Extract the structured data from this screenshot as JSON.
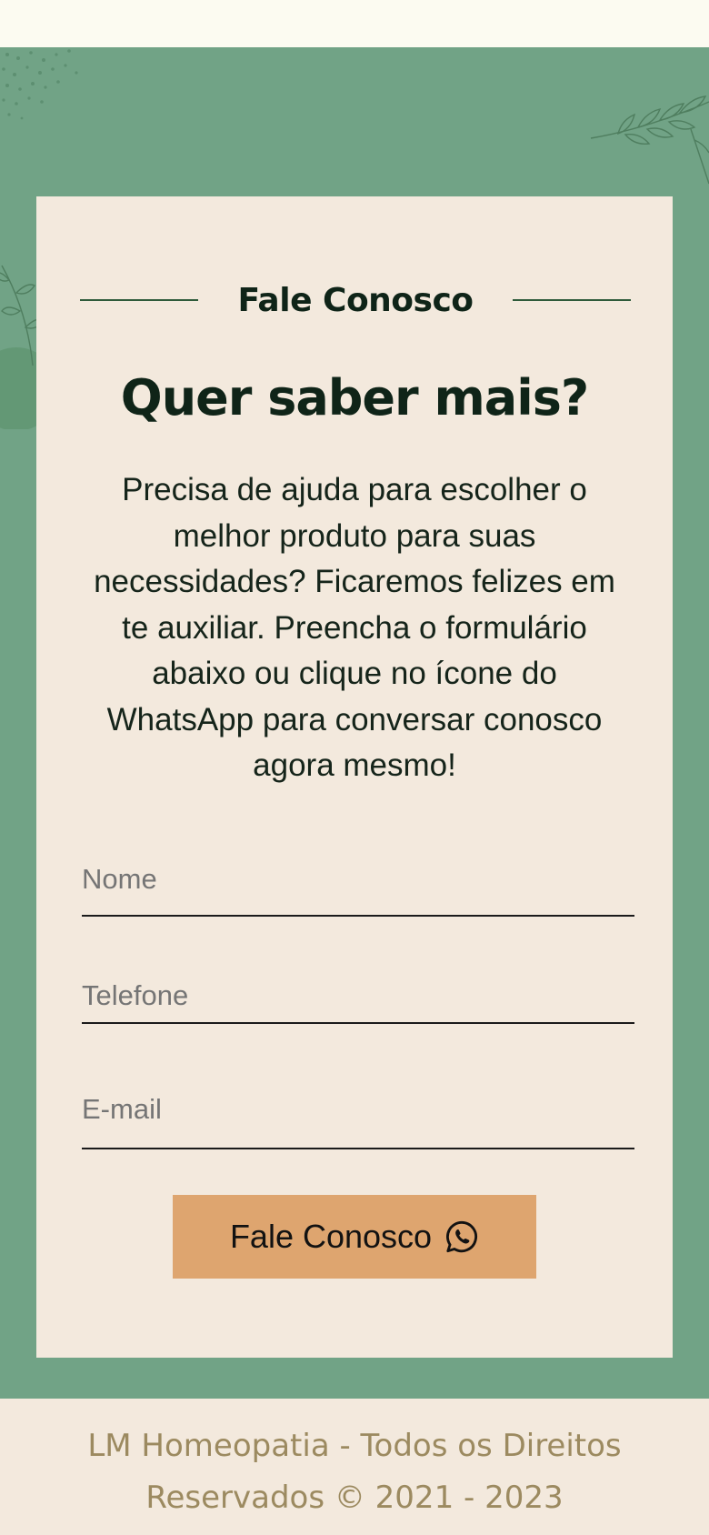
{
  "contact": {
    "section_title": "Fale Conosco",
    "headline": "Quer saber mais?",
    "description": "Precisa de ajuda para escolher o melhor produto para suas necessidades? Ficaremos felizes em te auxiliar. Preencha o formulário abaixo ou clique no ícone do WhatsApp para conversar conosco agora mesmo!",
    "form": {
      "name_placeholder": "Nome",
      "phone_placeholder": "Telefone",
      "email_placeholder": "E-mail",
      "submit_label": "Fale Conosco",
      "submit_icon": "whatsapp-icon"
    }
  },
  "footer": {
    "text": "LM Homeopatia - Todos os Direitos Reservados © 2021 - 2023"
  },
  "colors": {
    "background_green": "#71A386",
    "card_background": "#F3E9DD",
    "button_background": "#DEA56F",
    "heading_text": "#0F2418",
    "footer_text": "#9C8A60"
  }
}
